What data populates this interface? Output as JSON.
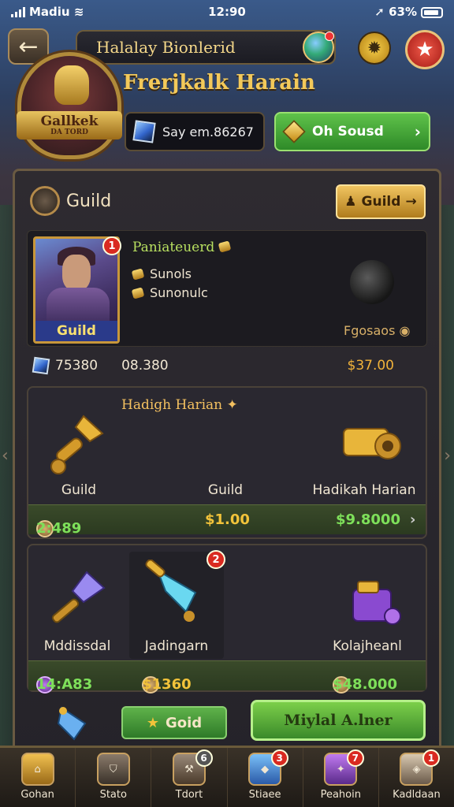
{
  "status": {
    "carrier": "Madiu",
    "time": "12:90",
    "battery": "63%"
  },
  "header": {
    "title": "Halalay Bionlerid",
    "crest_name": "Gallkek",
    "crest_sub": "DA TORD",
    "hero_name": "Frerjkalk Harain"
  },
  "search": {
    "placeholder": "Say em.86267"
  },
  "actions": {
    "green_button": "Oh Sousd"
  },
  "panel": {
    "title": "Guild",
    "guild_button": "Guild"
  },
  "card": {
    "portrait_label": "Guild",
    "portrait_badge": "1",
    "name": "Paniateuerd",
    "line1": "Sunols",
    "line2": "Sunonulc",
    "right_label": "Fgosaos",
    "stat1": "75380",
    "stat2": "08.380",
    "gold": "$37.00"
  },
  "section1": {
    "title": "Hadigh Harian",
    "items": [
      "Guild",
      "Guild",
      "Hadikah Harian"
    ],
    "bar": [
      "2:489",
      "$1.00",
      "$9.8000"
    ]
  },
  "section2": {
    "badge": "2",
    "items": [
      "Mddissdal",
      "Jadingarn",
      "Kolajheanl"
    ],
    "bar": [
      "14:A83",
      "$1360",
      "$48.000"
    ]
  },
  "bottom": {
    "small_button": "Goid",
    "big_button": "Miylal A.lner"
  },
  "nav": [
    {
      "label": "Gohan",
      "badge": ""
    },
    {
      "label": "Stato",
      "badge": ""
    },
    {
      "label": "Tdort",
      "badge": "6"
    },
    {
      "label": "Stiaee",
      "badge": "3"
    },
    {
      "label": "Peahoin",
      "badge": "7"
    },
    {
      "label": "Kadldaan",
      "badge": "1"
    }
  ],
  "colors": {
    "gold": "#f2c33a",
    "green": "#7ee05a",
    "panel": "#2e2b30"
  }
}
